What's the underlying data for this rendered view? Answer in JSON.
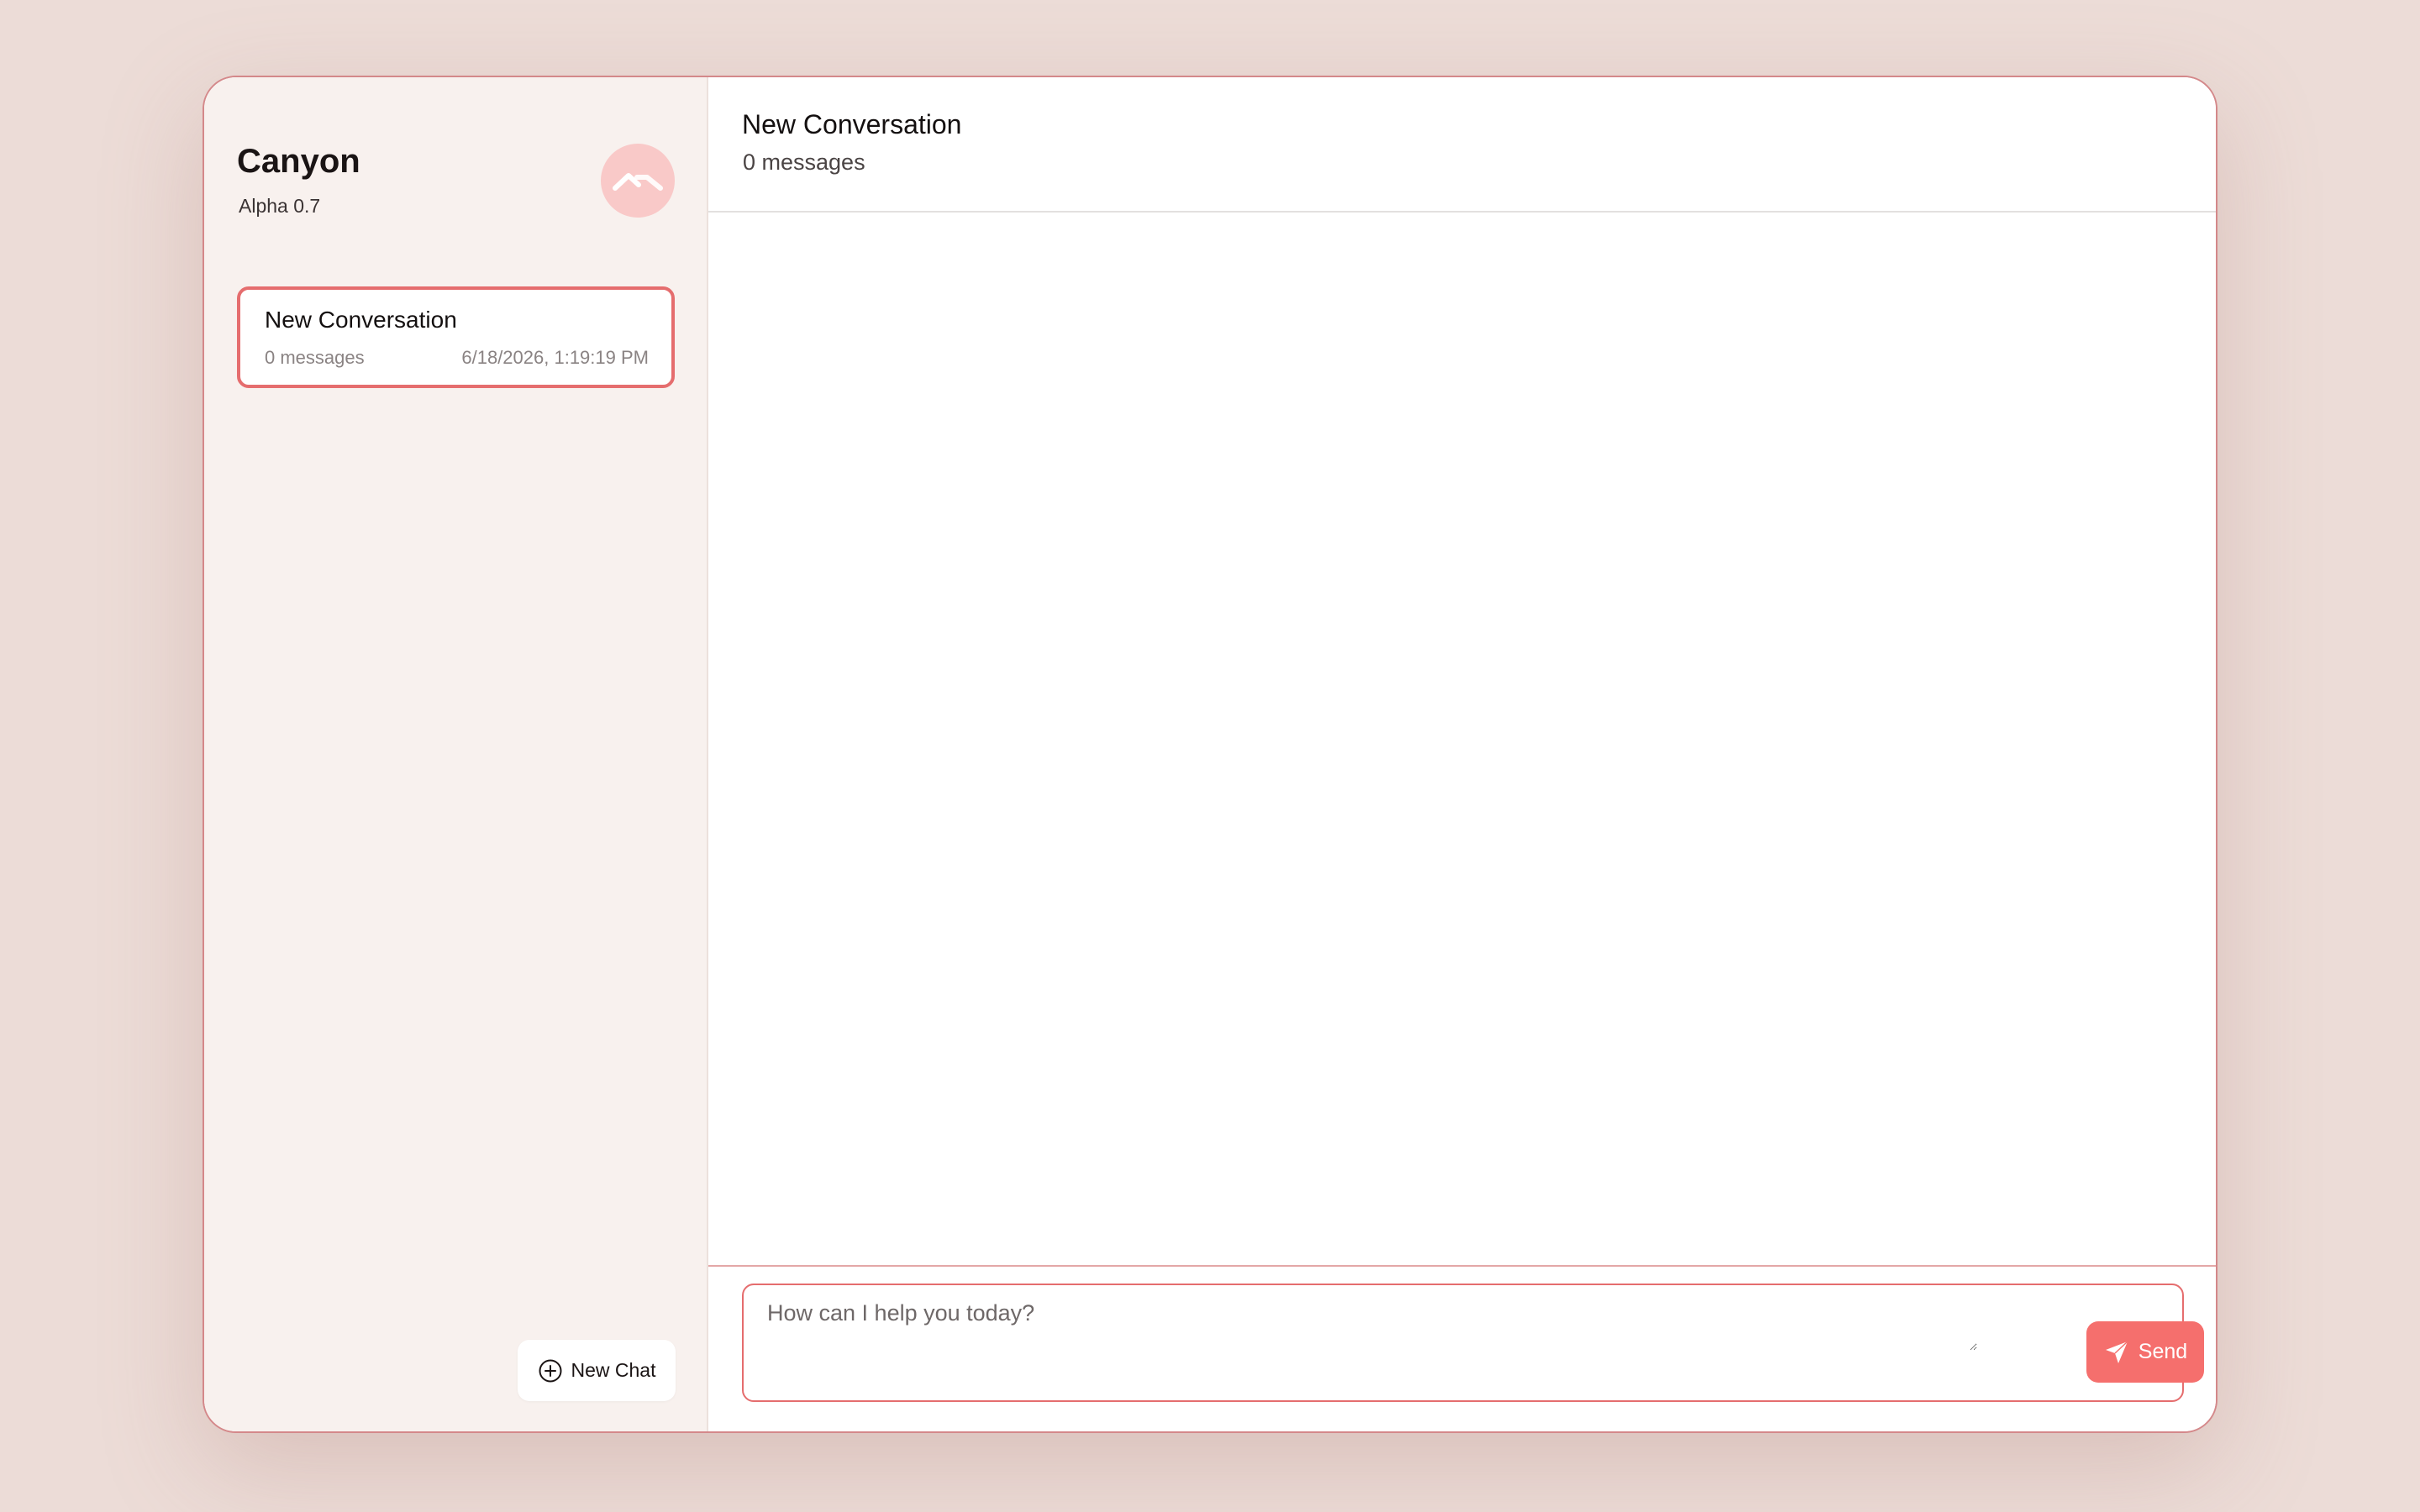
{
  "sidebar": {
    "brand": {
      "name": "Canyon",
      "version": "Alpha 0.7",
      "logo_icon": "mountain-peaks-icon"
    },
    "conversations": [
      {
        "title": "New Conversation",
        "message_count": "0 messages",
        "timestamp": "6/18/2026, 1:19:19 PM",
        "selected": true
      }
    ],
    "new_chat_button": {
      "label": "New Chat",
      "icon": "plus-circle-icon"
    }
  },
  "main": {
    "header": {
      "title": "New Conversation",
      "subtitle": "0 messages"
    },
    "composer": {
      "placeholder": "How can I help you today?",
      "value": "",
      "send_label": "Send",
      "send_icon": "send-arrow-icon"
    }
  },
  "colors": {
    "background": "#ecdcd7",
    "sidebar_bg": "#f8f1ee",
    "accent": "#f56f6d",
    "accent_border": "#e56d6e",
    "logo_badge": "#f9c9c8",
    "window_border": "#d4888a"
  }
}
